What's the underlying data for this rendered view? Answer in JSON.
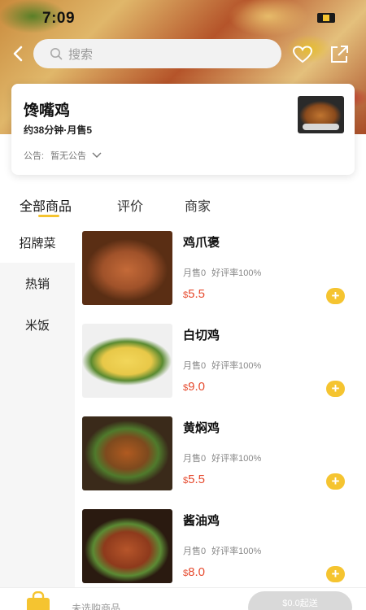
{
  "status_bar": {
    "time": "7:09"
  },
  "header": {
    "search_placeholder": "搜索"
  },
  "shop": {
    "name": "馋嘴鸡",
    "meta": "约38分钟·月售5",
    "notice_label": "公告:",
    "notice_text": "暂无公告"
  },
  "tabs": [
    {
      "label": "全部商品",
      "active": true
    },
    {
      "label": "评价",
      "active": false
    },
    {
      "label": "商家",
      "active": false
    }
  ],
  "categories": [
    {
      "label": "招牌菜",
      "active": true
    },
    {
      "label": "热销",
      "active": false
    },
    {
      "label": "米饭",
      "active": false
    }
  ],
  "products": [
    {
      "name": "鸡爪褒",
      "monthly_sales": "月售0",
      "rating": "好评率100%",
      "currency": "$",
      "price": "5.5"
    },
    {
      "name": "白切鸡",
      "monthly_sales": "月售0",
      "rating": "好评率100%",
      "currency": "$",
      "price": "9.0"
    },
    {
      "name": "黄焖鸡",
      "monthly_sales": "月售0",
      "rating": "好评率100%",
      "currency": "$",
      "price": "5.5"
    },
    {
      "name": "酱油鸡",
      "monthly_sales": "月售0",
      "rating": "好评率100%",
      "currency": "$",
      "price": "8.0"
    }
  ],
  "cart": {
    "empty_text": "未选购商品",
    "min_order": "$0.0起送"
  },
  "colors": {
    "accent": "#f5c430",
    "price": "#e64a2e"
  }
}
